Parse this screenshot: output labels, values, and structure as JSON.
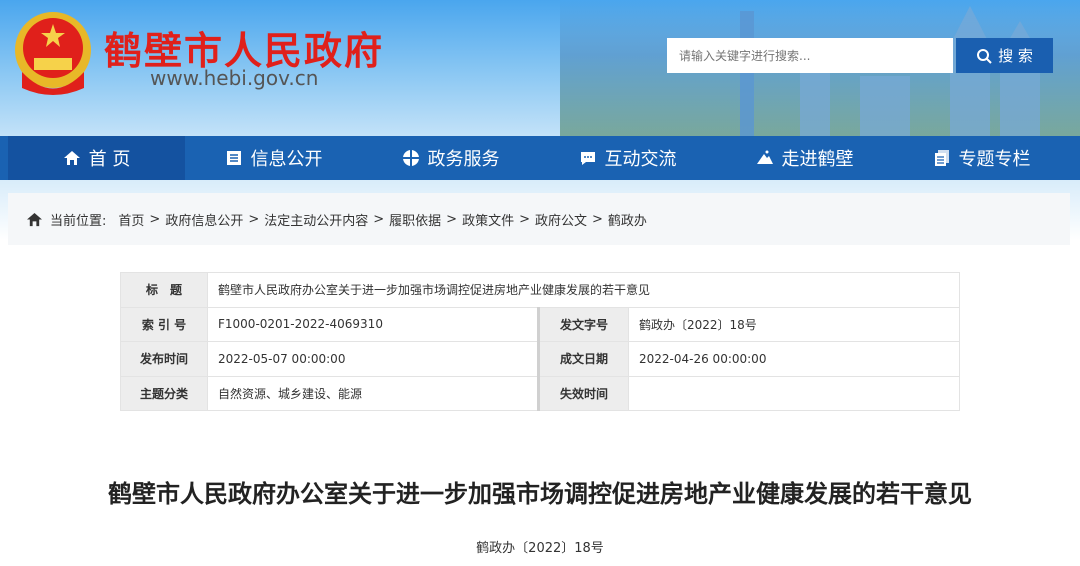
{
  "header": {
    "site_name": "鹤壁市人民政府",
    "url": "www.hebi.gov.cn",
    "search_placeholder": "请输入关键字进行搜索...",
    "search_label": "搜 索"
  },
  "nav": [
    {
      "label": "首 页",
      "icon": "home-icon"
    },
    {
      "label": "信息公开",
      "icon": "document-icon"
    },
    {
      "label": "政务服务",
      "icon": "service-icon"
    },
    {
      "label": "互动交流",
      "icon": "chat-icon"
    },
    {
      "label": "走进鹤壁",
      "icon": "mountain-icon"
    },
    {
      "label": "专题专栏",
      "icon": "files-icon"
    }
  ],
  "breadcrumb": {
    "prefix": "当前位置:",
    "items": [
      "首页",
      "政府信息公开",
      "法定主动公开内容",
      "履职依据",
      "政策文件",
      "政府公文",
      "鹤政办"
    ]
  },
  "meta": {
    "title_label": "标　题",
    "title": "鹤壁市人民政府办公室关于进一步加强市场调控促进房地产业健康发展的若干意见",
    "index_label": "索 引 号",
    "index": "F1000-0201-2022-4069310",
    "docno_label": "发文字号",
    "docno": "鹤政办〔2022〕18号",
    "pub_label": "发布时间",
    "pub": "2022-05-07 00:00:00",
    "made_label": "成文日期",
    "made": "2022-04-26 00:00:00",
    "topic_label": "主题分类",
    "topic": "自然资源、城乡建设、能源",
    "expire_label": "失效时间",
    "expire": ""
  },
  "document": {
    "title": "鹤壁市人民政府办公室关于进一步加强市场调控促进房地产业健康发展的若干意见",
    "number": "鹤政办〔2022〕18号"
  }
}
